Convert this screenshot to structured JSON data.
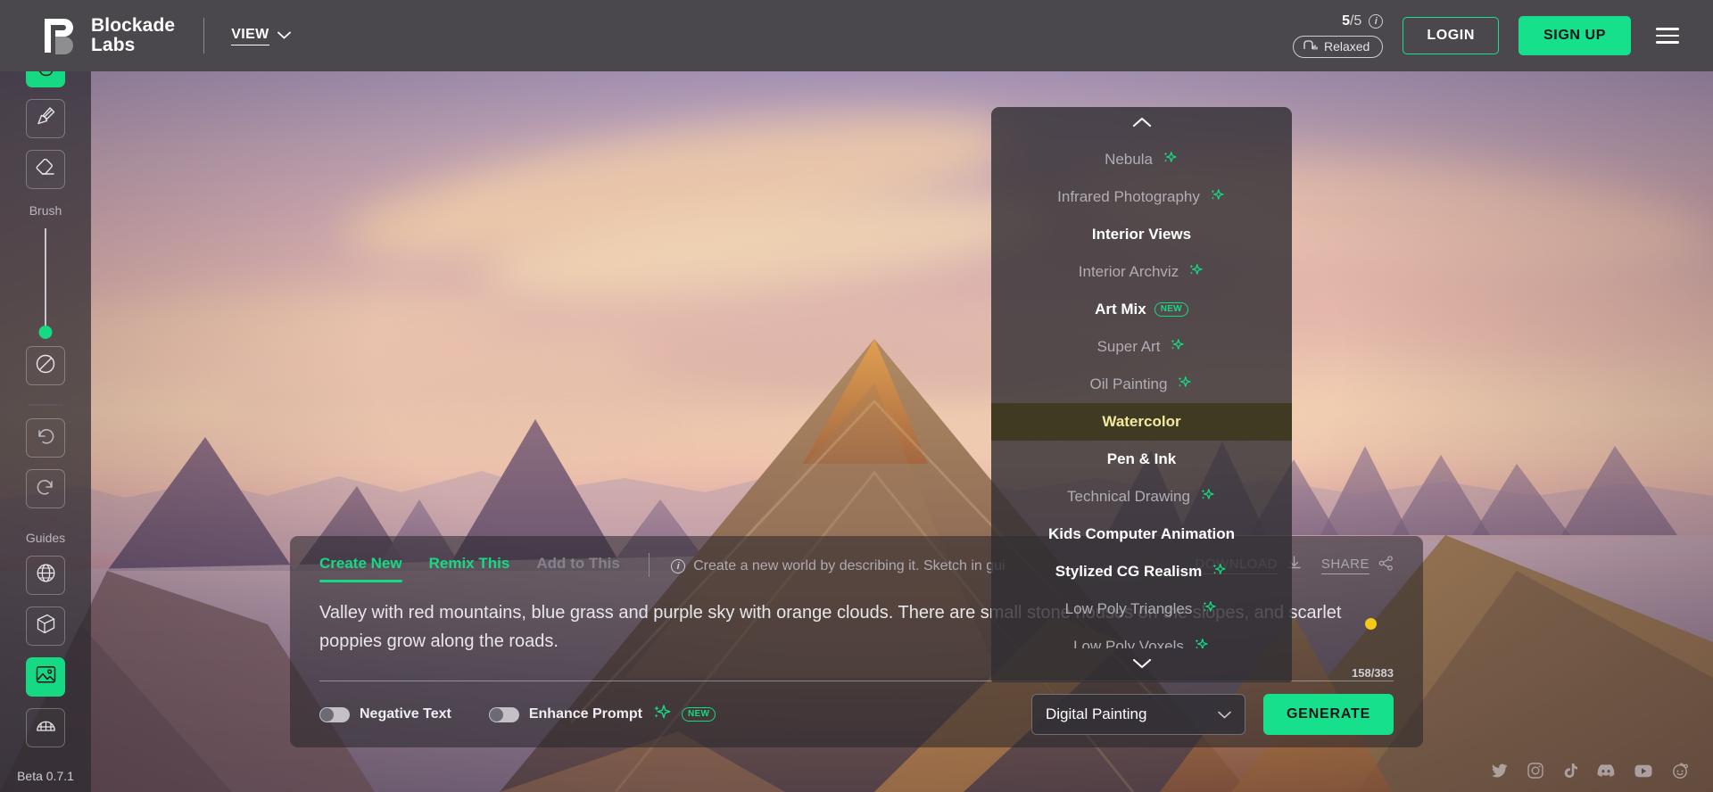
{
  "brand": {
    "name_line1": "Blockade",
    "name_line2": "Labs",
    "logo_icon": "blockade-logo-icon"
  },
  "topbar": {
    "view_label": "VIEW",
    "view_chevron_icon": "chevron-down-icon",
    "credits_used": "5",
    "credits_separator": "/",
    "credits_total": "5",
    "info_icon": "info-icon",
    "info_glyph": "i",
    "queue_icon": "queue-icon",
    "queue_label": "Relaxed",
    "login_label": "LOGIN",
    "signup_label": "SIGN UP",
    "menu_icon": "hamburger-menu-icon"
  },
  "rail": {
    "tools": [
      {
        "name": "hand-tool",
        "icon": "hand-icon",
        "active": true
      },
      {
        "name": "brush-tool",
        "icon": "paintbrush-icon",
        "active": false
      },
      {
        "name": "eraser-tool",
        "icon": "eraser-icon",
        "active": false
      }
    ],
    "brush_label": "Brush",
    "slider_name": "brush-size-slider",
    "no_color": {
      "name": "no-color-tool",
      "icon": "no-color-circle-icon"
    },
    "undo": {
      "name": "undo-button",
      "icon": "undo-arrow-icon"
    },
    "redo": {
      "name": "redo-button",
      "icon": "redo-arrow-icon"
    },
    "guides_label": "Guides",
    "guides": [
      {
        "name": "guide-sphere",
        "icon": "globe-icon",
        "active": false
      },
      {
        "name": "guide-cube",
        "icon": "cube-icon",
        "active": false
      },
      {
        "name": "guide-image",
        "icon": "image-icon",
        "active": true
      },
      {
        "name": "guide-dome",
        "icon": "dome-grid-icon",
        "active": false
      }
    ],
    "beta_label": "Beta 0.7.1"
  },
  "style_dropdown": {
    "scroll_up_icon": "chevron-up-icon",
    "scroll_down_icon": "chevron-down-icon",
    "items": [
      {
        "label": "Nebula",
        "sparkle": true,
        "bold": false,
        "selected": false
      },
      {
        "label": "Infrared Photography",
        "sparkle": true,
        "bold": false,
        "selected": false
      },
      {
        "label": "Interior Views",
        "sparkle": false,
        "bold": true,
        "selected": false
      },
      {
        "label": "Interior Archviz",
        "sparkle": true,
        "bold": false,
        "selected": false
      },
      {
        "label": "Art Mix",
        "sparkle": false,
        "bold": true,
        "selected": false,
        "badge": "NEW"
      },
      {
        "label": "Super Art",
        "sparkle": true,
        "bold": false,
        "selected": false
      },
      {
        "label": "Oil Painting",
        "sparkle": true,
        "bold": false,
        "selected": false
      },
      {
        "label": "Watercolor",
        "sparkle": false,
        "bold": true,
        "selected": true
      },
      {
        "label": "Pen & Ink",
        "sparkle": false,
        "bold": true,
        "selected": false
      },
      {
        "label": "Technical Drawing",
        "sparkle": true,
        "bold": false,
        "selected": false
      },
      {
        "label": "Kids Computer Animation",
        "sparkle": false,
        "bold": true,
        "selected": false
      },
      {
        "label": "Stylized CG Realism",
        "sparkle": true,
        "bold": true,
        "selected": false
      },
      {
        "label": "Low Poly Triangles",
        "sparkle": true,
        "bold": false,
        "selected": false
      },
      {
        "label": "Low Poly Voxels",
        "sparkle": true,
        "bold": false,
        "selected": false
      }
    ]
  },
  "panel": {
    "tabs": [
      {
        "label": "Create New",
        "active": true,
        "dim": false
      },
      {
        "label": "Remix This",
        "active": false,
        "dim": false
      },
      {
        "label": "Add to This",
        "active": false,
        "dim": true
      }
    ],
    "hint_icon": "info-icon",
    "hint_glyph": "i",
    "hint_text": "Create a new world by describing it. Sketch in gui",
    "download_label": "DOWNLOAD",
    "download_icon": "download-icon",
    "share_label": "SHARE",
    "share_icon": "share-icon",
    "prompt_value": "Valley with red mountains, blue grass and purple sky with orange clouds. There are small stone houses on the slopes, and scarlet poppies grow along the roads.",
    "char_count": "158/383",
    "status_dot_color": "#f5ca16",
    "toggles": [
      {
        "name": "negative-text-toggle",
        "label": "Negative Text",
        "on": false,
        "sparkle": false,
        "badge": null
      },
      {
        "name": "enhance-prompt-toggle",
        "label": "Enhance Prompt",
        "on": false,
        "sparkle": true,
        "badge": "NEW"
      }
    ],
    "style_select_value": "Digital Painting",
    "style_select_chevron": "chevron-down-icon",
    "generate_label": "GENERATE"
  },
  "social": [
    {
      "name": "twitter-icon"
    },
    {
      "name": "instagram-icon"
    },
    {
      "name": "tiktok-icon"
    },
    {
      "name": "discord-icon"
    },
    {
      "name": "youtube-icon"
    },
    {
      "name": "reddit-icon"
    }
  ],
  "colors": {
    "accent": "#16e08c",
    "selected_text": "#f2e9a0",
    "status": "#f5ca16"
  }
}
